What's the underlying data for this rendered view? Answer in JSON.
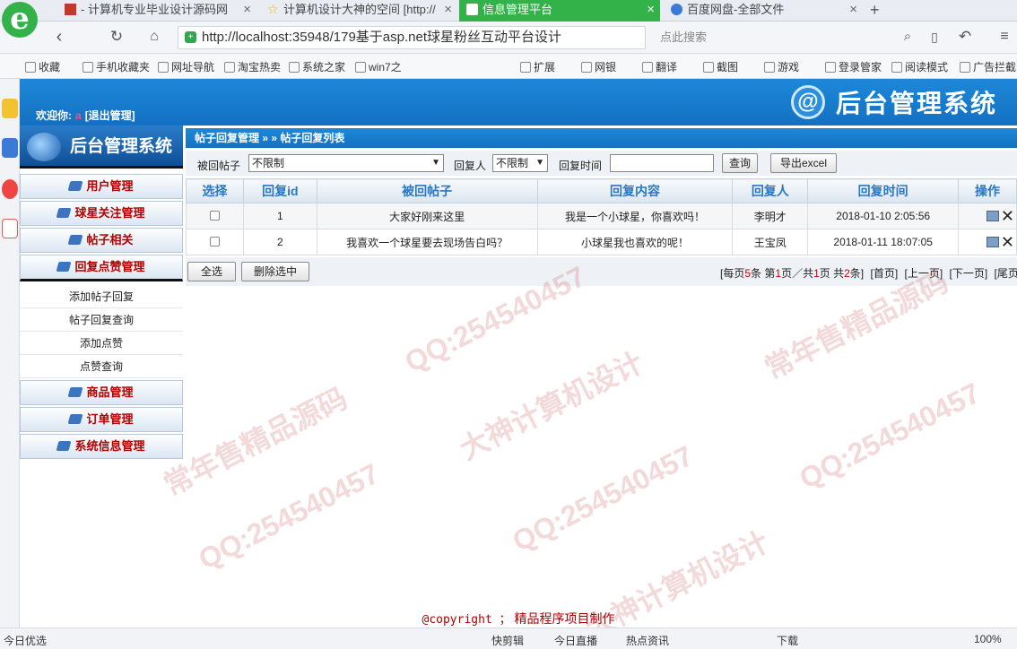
{
  "browser": {
    "tabs": [
      {
        "label": "- 计算机专业毕业设计源码网",
        "active": false
      },
      {
        "label": "计算机设计大神的空间 [http://",
        "active": false
      },
      {
        "label": "信息管理平台",
        "active": true
      },
      {
        "label": "百度网盘-全部文件",
        "active": false
      }
    ],
    "new_tab": "+",
    "url": "http://localhost:35948/179基于asp.net球星粉丝互动平台设计",
    "search_placeholder": "点此搜索",
    "bookmarks": [
      "收藏",
      "手机收藏夹",
      "网址导航",
      "淘宝热卖",
      "系统之家",
      "win7之"
    ],
    "toolbar_right": [
      "扩展",
      "网银",
      "翻译",
      "截图",
      "游戏",
      "登录管家",
      "阅读模式",
      "广告拦截"
    ],
    "status_left": "今日优选",
    "status_items": [
      "快剪辑",
      "今日直播",
      "热点资讯",
      "下载"
    ],
    "zoom": "100%"
  },
  "header": {
    "welcome_label": "欢迎你:",
    "user": "a",
    "logout": "[退出管理]",
    "system_title": "后台管理系统",
    "at_glyph": "@"
  },
  "sidebar": {
    "brand": "后台管理系统",
    "menus": [
      {
        "label": "用户管理"
      },
      {
        "label": "球星关注管理"
      },
      {
        "label": "帖子相关"
      },
      {
        "label": "回复点赞管理"
      }
    ],
    "submenu": [
      "添加帖子回复",
      "帖子回复查询",
      "添加点赞",
      "点赞查询"
    ],
    "menus_after": [
      {
        "label": "商品管理"
      },
      {
        "label": "订单管理"
      },
      {
        "label": "系统信息管理"
      }
    ]
  },
  "breadcrumb": "帖子回复管理 » » 帖子回复列表",
  "filter": {
    "post_label": "被回帖子",
    "post_value": "不限制",
    "replier_label": "回复人",
    "replier_value": "不限制",
    "time_label": "回复时间",
    "query_button": "查询",
    "export_button": "导出excel"
  },
  "table": {
    "headers": [
      "选择",
      "回复id",
      "被回帖子",
      "回复内容",
      "回复人",
      "回复时间",
      "操作"
    ],
    "rows": [
      {
        "id": "1",
        "post": "大家好刚来这里",
        "content": "我是一个小球星，你喜欢吗！",
        "user": "李明才",
        "time": "2018-01-10 2:05:56"
      },
      {
        "id": "2",
        "post": "我喜欢一个球星要去现场告白吗？",
        "content": "小球星我也喜欢的呢！",
        "user": "王宝凤",
        "time": "2018-01-11 18:07:05"
      }
    ]
  },
  "pager": {
    "select_all": "全选",
    "delete_selected": "删除选中",
    "info_prefix": "[每页",
    "per_page": "5",
    "info_mid1": "条 第",
    "current_page": "1",
    "info_mid2": "页／共",
    "total_pages": "1",
    "info_mid3": "页 共",
    "total_items": "2",
    "info_suffix": "条]",
    "first": "[首页]",
    "prev": "[上一页]",
    "next": "[下一页]",
    "last": "[尾页]"
  },
  "footer": {
    "copyright": "@copyright ；",
    "credit": "精品程序项目制作"
  },
  "watermarks": [
    "QQ:254540457",
    "大神计算机设计",
    "常年售精品源码"
  ]
}
